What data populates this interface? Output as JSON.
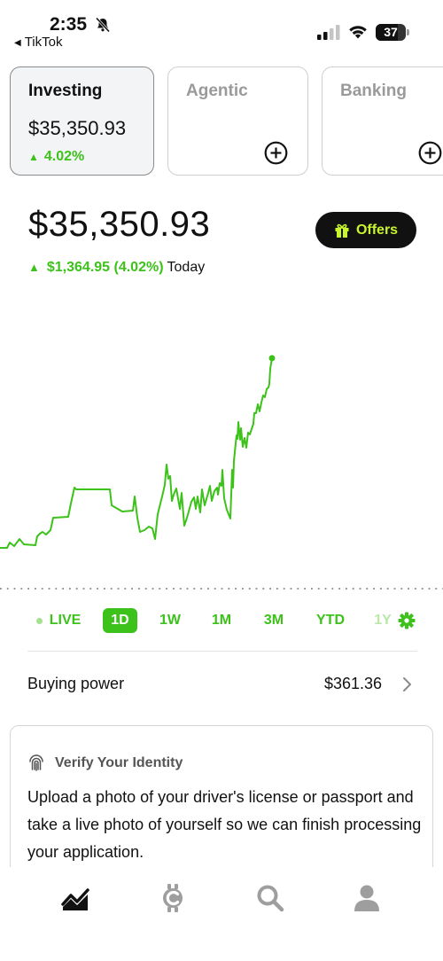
{
  "status_bar": {
    "time": "2:35",
    "back_app": "TikTok",
    "battery": "37"
  },
  "accounts": [
    {
      "title": "Investing",
      "amount": "$35,350.93",
      "change": "4.02%",
      "active": true
    },
    {
      "title": "Agentic"
    },
    {
      "title": "Banking"
    }
  ],
  "portfolio": {
    "balance": "$35,350.93",
    "gain": "$1,364.95 (4.02%)",
    "period": "Today",
    "offers_label": "Offers"
  },
  "colors": {
    "accent": "#3cc21a",
    "offers_text": "#c8f52c"
  },
  "ranges": {
    "live": "LIVE",
    "d1": "1D",
    "w1": "1W",
    "m1": "1M",
    "m3": "3M",
    "ytd": "YTD",
    "y1": "1Y",
    "selected": "1D"
  },
  "buying_power": {
    "label": "Buying power",
    "value": "$361.36"
  },
  "verify": {
    "title": "Verify Your Identity",
    "body": "Upload a photo of your driver's license or passport and take a live photo of yourself so we can finish processing your application."
  },
  "nav": {
    "icons": [
      "investing-chart-icon",
      "crypto-icon",
      "search-icon",
      "profile-icon"
    ]
  }
}
